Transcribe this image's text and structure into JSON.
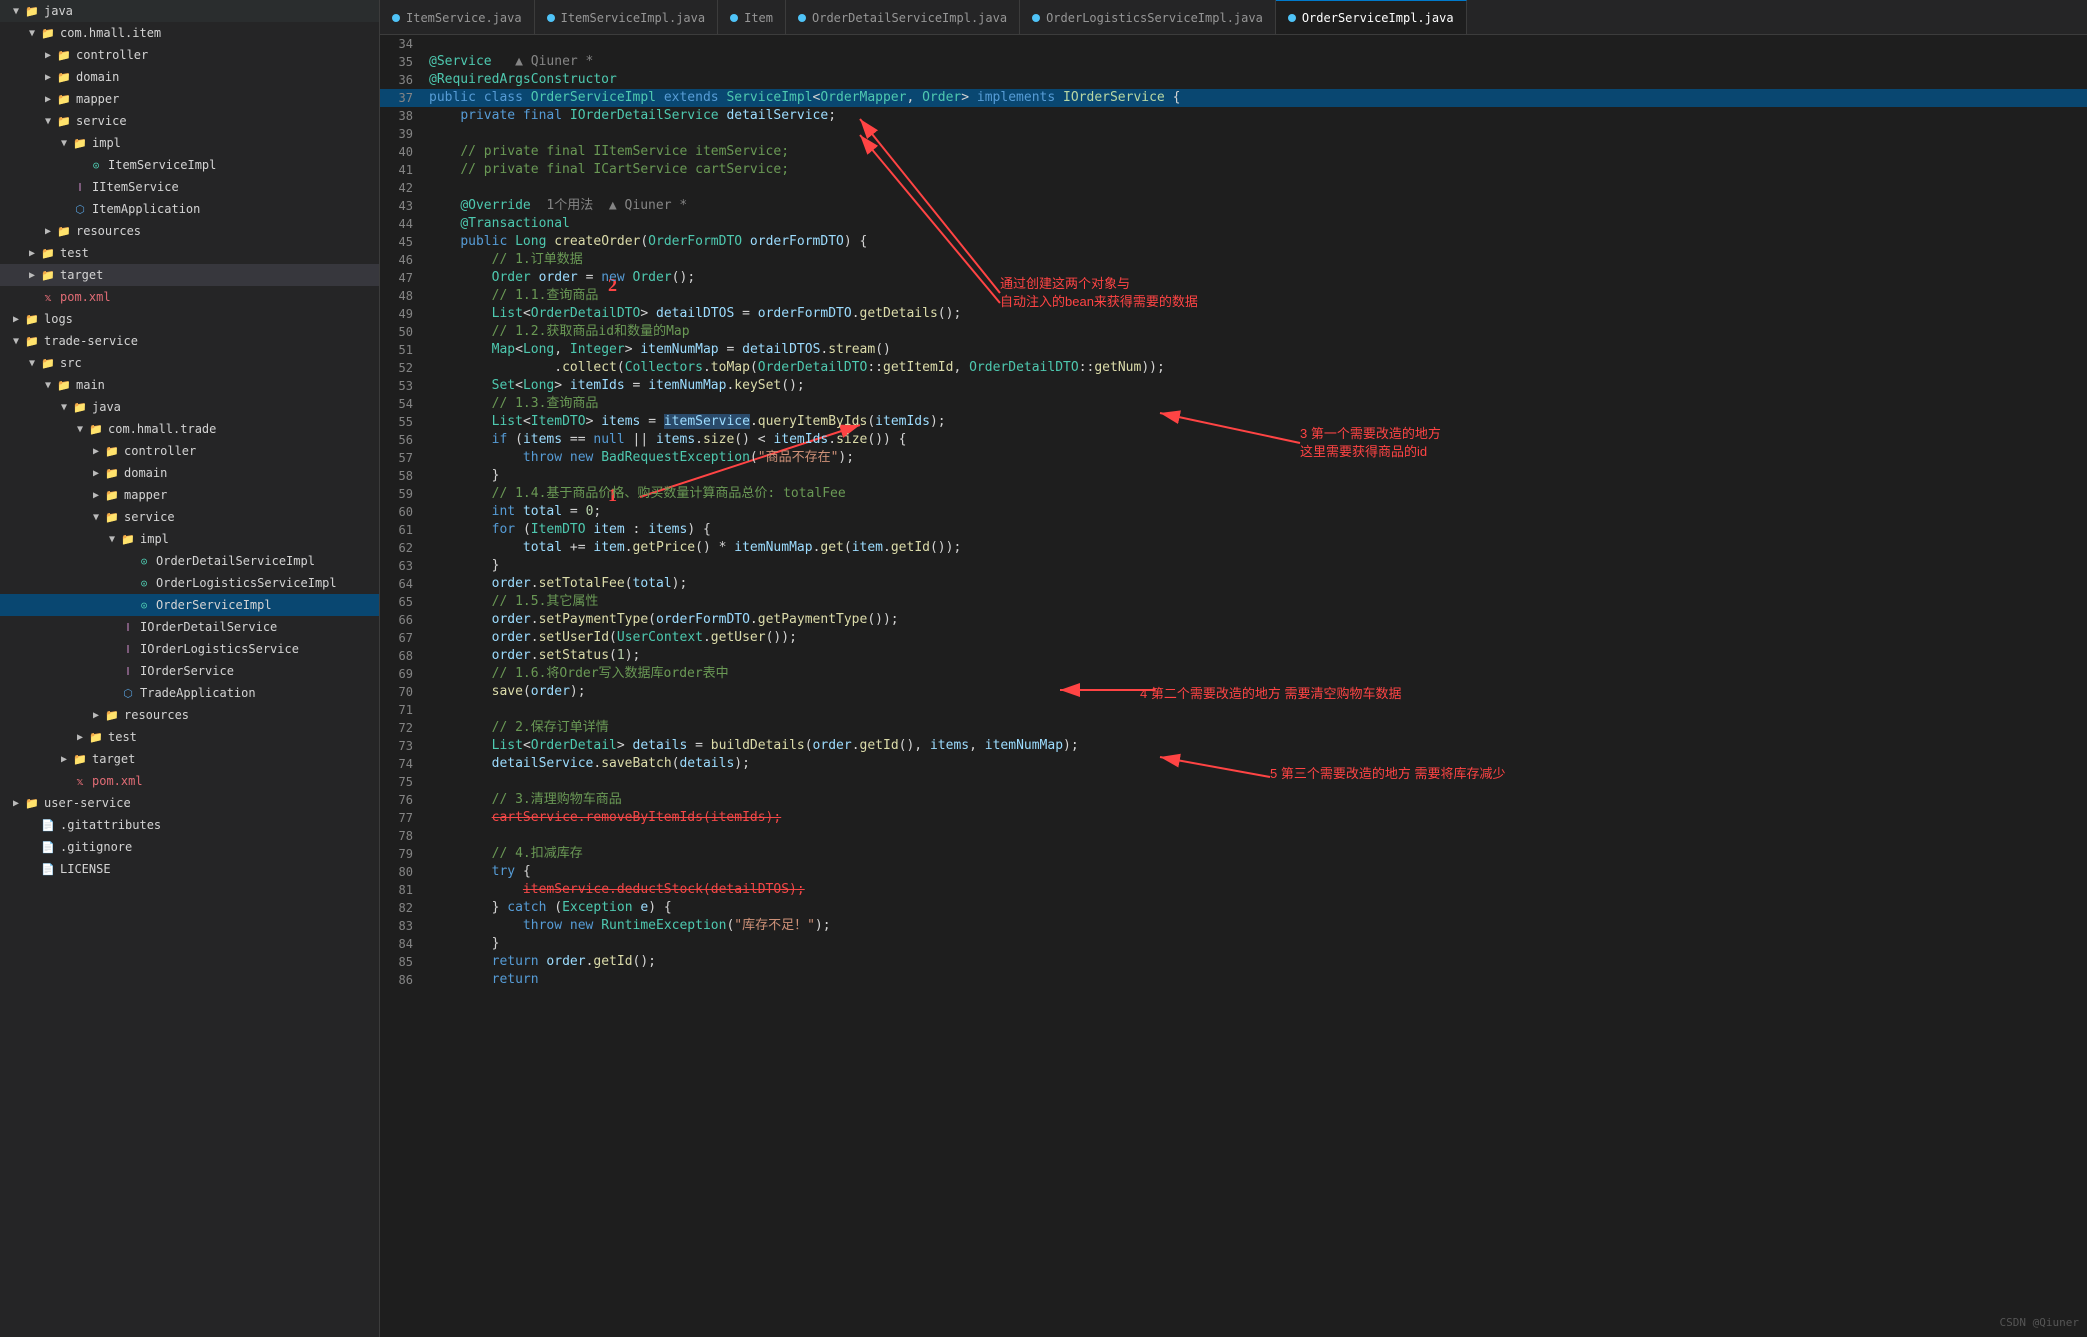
{
  "sidebar": {
    "items": [
      {
        "id": "java-root",
        "label": "java",
        "level": 0,
        "type": "folder",
        "expanded": true
      },
      {
        "id": "com-hmall-item",
        "label": "com.hmall.item",
        "level": 1,
        "type": "folder",
        "expanded": true
      },
      {
        "id": "controller1",
        "label": "controller",
        "level": 2,
        "type": "folder",
        "expanded": false
      },
      {
        "id": "domain1",
        "label": "domain",
        "level": 2,
        "type": "folder",
        "expanded": false
      },
      {
        "id": "mapper1",
        "label": "mapper",
        "level": 2,
        "type": "folder",
        "expanded": false
      },
      {
        "id": "service1",
        "label": "service",
        "level": 2,
        "type": "folder",
        "expanded": true
      },
      {
        "id": "impl1",
        "label": "impl",
        "level": 3,
        "type": "folder",
        "expanded": true
      },
      {
        "id": "ItemServiceImpl",
        "label": "ItemServiceImpl",
        "level": 4,
        "type": "java",
        "expanded": false
      },
      {
        "id": "IItemService",
        "label": "IItemService",
        "level": 3,
        "type": "interface",
        "expanded": false
      },
      {
        "id": "ItemApplication",
        "label": "ItemApplication",
        "level": 3,
        "type": "java",
        "expanded": false
      },
      {
        "id": "resources1",
        "label": "resources",
        "level": 2,
        "type": "folder",
        "expanded": false
      },
      {
        "id": "test1",
        "label": "test",
        "level": 1,
        "type": "folder",
        "expanded": false
      },
      {
        "id": "target1",
        "label": "target",
        "level": 1,
        "type": "folder",
        "expanded": false,
        "highlighted": true
      },
      {
        "id": "pom-item",
        "label": "pom.xml",
        "level": 1,
        "type": "xml",
        "expanded": false
      },
      {
        "id": "logs",
        "label": "logs",
        "level": 0,
        "type": "folder",
        "expanded": false
      },
      {
        "id": "trade-service",
        "label": "trade-service",
        "level": 0,
        "type": "folder",
        "expanded": true
      },
      {
        "id": "src",
        "label": "src",
        "level": 1,
        "type": "folder",
        "expanded": true
      },
      {
        "id": "main",
        "label": "main",
        "level": 2,
        "type": "folder",
        "expanded": true
      },
      {
        "id": "java-trade",
        "label": "java",
        "level": 3,
        "type": "folder",
        "expanded": true
      },
      {
        "id": "com-hmall-trade",
        "label": "com.hmall.trade",
        "level": 4,
        "type": "folder",
        "expanded": true
      },
      {
        "id": "controller2",
        "label": "controller",
        "level": 5,
        "type": "folder",
        "expanded": false
      },
      {
        "id": "domain2",
        "label": "domain",
        "level": 5,
        "type": "folder",
        "expanded": false
      },
      {
        "id": "mapper2",
        "label": "mapper",
        "level": 5,
        "type": "folder",
        "expanded": false
      },
      {
        "id": "service2",
        "label": "service",
        "level": 5,
        "type": "folder",
        "expanded": true
      },
      {
        "id": "impl2",
        "label": "impl",
        "level": 6,
        "type": "folder",
        "expanded": true
      },
      {
        "id": "OrderDetailServiceImpl",
        "label": "OrderDetailServiceImpl",
        "level": 7,
        "type": "java",
        "expanded": false
      },
      {
        "id": "OrderLogisticsServiceImpl",
        "label": "OrderLogisticsServiceImpl",
        "level": 7,
        "type": "java",
        "expanded": false
      },
      {
        "id": "OrderServiceImpl",
        "label": "OrderServiceImpl",
        "level": 7,
        "type": "java",
        "expanded": false,
        "active": true
      },
      {
        "id": "IOrderDetailService",
        "label": "IOrderDetailService",
        "level": 6,
        "type": "interface",
        "expanded": false
      },
      {
        "id": "IOrderLogisticsService",
        "label": "IOrderLogisticsService",
        "level": 6,
        "type": "interface",
        "expanded": false
      },
      {
        "id": "IOrderService",
        "label": "IOrderService",
        "level": 6,
        "type": "interface",
        "expanded": false
      },
      {
        "id": "TradeApplication",
        "label": "TradeApplication",
        "level": 6,
        "type": "java",
        "expanded": false
      },
      {
        "id": "resources2",
        "label": "resources",
        "level": 5,
        "type": "folder",
        "expanded": false
      },
      {
        "id": "test2",
        "label": "test",
        "level": 4,
        "type": "folder",
        "expanded": false
      },
      {
        "id": "target2",
        "label": "target",
        "level": 3,
        "type": "folder",
        "expanded": false
      },
      {
        "id": "pom-trade",
        "label": "pom.xml",
        "level": 3,
        "type": "xml",
        "expanded": false
      },
      {
        "id": "user-service",
        "label": "user-service",
        "level": 0,
        "type": "folder",
        "expanded": false
      },
      {
        "id": "gitattributes",
        "label": ".gitattributes",
        "level": 0,
        "type": "file",
        "expanded": false
      },
      {
        "id": "gitignore",
        "label": ".gitignore",
        "level": 0,
        "type": "file",
        "expanded": false
      },
      {
        "id": "LICENSE",
        "label": "LICENSE",
        "level": 0,
        "type": "file",
        "expanded": false
      }
    ]
  },
  "tabs": [
    {
      "id": "ItemService",
      "label": "ItemService.java",
      "color": "blue",
      "active": false
    },
    {
      "id": "ItemServiceImpl",
      "label": "ItemServiceImpl.java",
      "color": "blue",
      "active": false
    },
    {
      "id": "Item",
      "label": "Item",
      "color": "blue",
      "active": false
    },
    {
      "id": "OrderDetailServiceImpl",
      "label": "OrderDetailServiceImpl.java",
      "color": "blue",
      "active": false
    },
    {
      "id": "OrderLogisticsServiceImpl",
      "label": "OrderLogisticsServiceImpl.java",
      "color": "blue",
      "active": false
    },
    {
      "id": "OrderServiceImpl",
      "label": "OrderServiceImpl.java",
      "color": "blue",
      "active": true
    }
  ],
  "annotations": {
    "num1": "1",
    "num2": "2",
    "callout1": "通过创建这两个对象与\n自动注入的bean来获得需要的数据",
    "callout3": "3 第一个需要改造的地方\n这里需要获得商品的id",
    "callout4": "4 第二个需要改造的地方 需要清空购物车数据",
    "callout5": "5 第三个需要改造的地方 需要将库存减少"
  },
  "watermark": "CSDN @Qiuner"
}
